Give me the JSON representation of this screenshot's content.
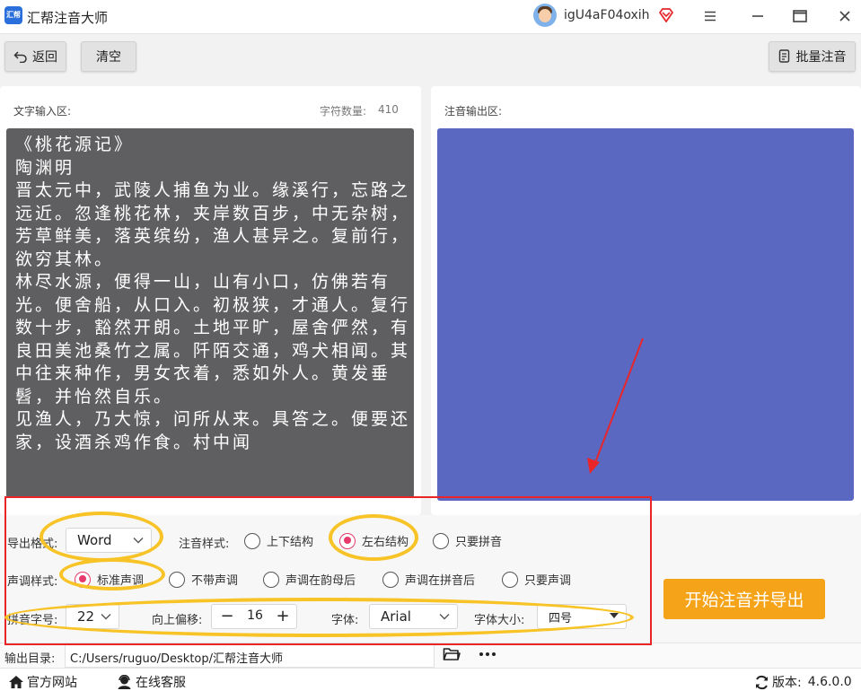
{
  "app": {
    "title": "汇帮注音大师",
    "logo_text": "汇帮",
    "username": "igU4aF04oxih"
  },
  "toolbar": {
    "back_label": "返回",
    "clear_label": "清空",
    "batch_label": "批量注音"
  },
  "input": {
    "label": "文字输入区:",
    "char_count_label": "字符数量:",
    "char_count": "410",
    "text": "《桃花源记》\n陶渊明\n晋太元中，武陵人捕鱼为业。缘溪行，忘路之远近。忽逢桃花林，夹岸数百步，中无杂树，芳草鲜美，落英缤纷，渔人甚异之。复前行，欲穷其林。\n林尽水源，便得一山，山有小口，仿佛若有光。便舍船，从口入。初极狭，才通人。复行数十步，豁然开朗。土地平旷，屋舍俨然，有良田美池桑竹之属。阡陌交通，鸡犬相闻。其中往来种作，男女衣着，悉如外人。黄发垂髫，并怡然自乐。\n见渔人，乃大惊，问所从来。具答之。便要还家，设酒杀鸡作食。村中闻"
  },
  "output": {
    "label": "注音输出区:"
  },
  "settings": {
    "export_format_label": "导出格式:",
    "export_format": "Word",
    "pinyin_style_label": "注音样式:",
    "pinyin_styles": [
      {
        "label": "上下结构",
        "checked": false
      },
      {
        "label": "左右结构",
        "checked": true
      },
      {
        "label": "只要拼音",
        "checked": false
      }
    ],
    "tone_style_label": "声调样式:",
    "tone_styles": [
      {
        "label": "标准声调",
        "checked": true
      },
      {
        "label": "不带声调",
        "checked": false
      },
      {
        "label": "声调在韵母后",
        "checked": false
      },
      {
        "label": "声调在拼音后",
        "checked": false
      },
      {
        "label": "只要声调",
        "checked": false
      }
    ],
    "pinyin_size_label": "拼音字号:",
    "pinyin_size": "22",
    "offset_label": "向上偏移:",
    "offset_value": "16",
    "font_label": "字体:",
    "font_value": "Arial",
    "font_size_label": "字体大小:",
    "font_size_value": "四号",
    "start_label": "开始注音并导出"
  },
  "output_dir": {
    "label": "输出目录:",
    "path": "C:/Users/ruguo/Desktop/汇帮注音大师"
  },
  "status": {
    "website_label": "官方网站",
    "service_label": "在线客服",
    "version_label": "版本:",
    "version": "4.6.0.0"
  },
  "colors": {
    "accent": "#f5a318",
    "output_bg": "#5b68c2",
    "input_bg": "#5f5f62",
    "radio_checked": "#e53a6b",
    "annotation_red": "#e8262a",
    "annotation_yellow": "#f7c326"
  },
  "icons": [
    "app-logo",
    "user-avatar",
    "vip-diamond-icon",
    "menu-icon",
    "minimize-icon",
    "maximize-icon",
    "close-icon",
    "back-icon",
    "batch-doc-icon",
    "chevron-down-icon",
    "folder-icon",
    "more-icon",
    "home-icon",
    "support-icon",
    "refresh-icon"
  ]
}
